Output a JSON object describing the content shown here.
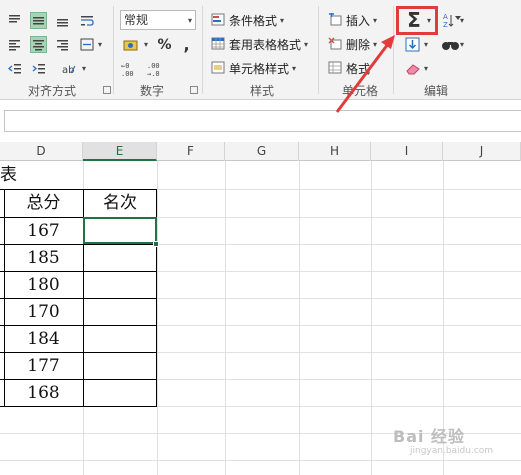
{
  "ribbon": {
    "groups": {
      "alignment": "对齐方式",
      "number": "数字",
      "styles": "样式",
      "cells": "单元格",
      "editing": "编辑"
    },
    "number_format": "常规",
    "percent_symbol": "%",
    "comma_symbol": ",",
    "styles_items": [
      "条件格式",
      "套用表格格式",
      "单元格样式"
    ],
    "cells_items": [
      "插入",
      "删除",
      "格式"
    ],
    "editing_sigma": "Σ"
  },
  "columns": {
    "D": "D",
    "E": "E",
    "F": "F",
    "G": "G",
    "H": "H",
    "I": "I",
    "J": "J"
  },
  "table": {
    "title_fragment": "表",
    "header_total": "总分",
    "header_rank": "名次",
    "totals": [
      "167",
      "185",
      "180",
      "170",
      "184",
      "177",
      "168"
    ]
  },
  "watermark": {
    "text": "Bai 经验",
    "sub": "jingyan.baidu.com"
  },
  "colors": {
    "accent": "#217346",
    "highlight": "#e23b3b"
  }
}
